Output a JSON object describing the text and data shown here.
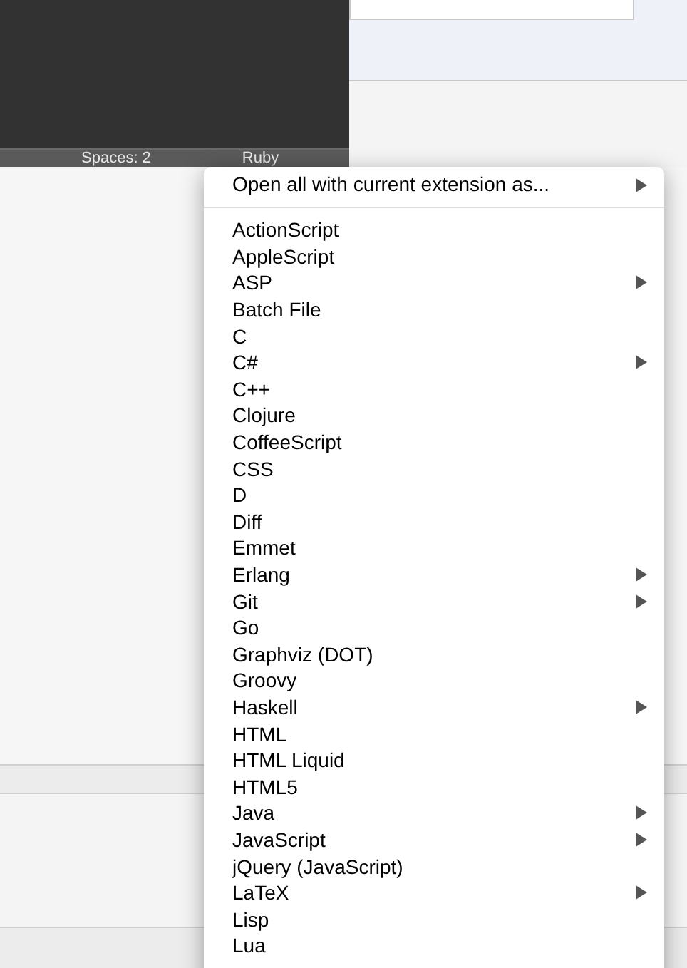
{
  "status_bar": {
    "spaces": "Spaces: 2",
    "syntax": "Ruby"
  },
  "menu": {
    "header": {
      "label": "Open all with current extension as...",
      "submenu": true
    },
    "items": [
      {
        "label": "ActionScript",
        "submenu": false
      },
      {
        "label": "AppleScript",
        "submenu": false
      },
      {
        "label": "ASP",
        "submenu": true
      },
      {
        "label": "Batch File",
        "submenu": false
      },
      {
        "label": "C",
        "submenu": false
      },
      {
        "label": "C#",
        "submenu": true
      },
      {
        "label": "C++",
        "submenu": false
      },
      {
        "label": "Clojure",
        "submenu": false
      },
      {
        "label": "CoffeeScript",
        "submenu": false
      },
      {
        "label": "CSS",
        "submenu": false
      },
      {
        "label": "D",
        "submenu": false
      },
      {
        "label": "Diff",
        "submenu": false
      },
      {
        "label": "Emmet",
        "submenu": false
      },
      {
        "label": "Erlang",
        "submenu": true
      },
      {
        "label": "Git",
        "submenu": true
      },
      {
        "label": "Go",
        "submenu": false
      },
      {
        "label": "Graphviz (DOT)",
        "submenu": false
      },
      {
        "label": "Groovy",
        "submenu": false
      },
      {
        "label": "Haskell",
        "submenu": true
      },
      {
        "label": "HTML",
        "submenu": false
      },
      {
        "label": "HTML Liquid",
        "submenu": false
      },
      {
        "label": "HTML5",
        "submenu": false
      },
      {
        "label": "Java",
        "submenu": true
      },
      {
        "label": "JavaScript",
        "submenu": true
      },
      {
        "label": "jQuery (JavaScript)",
        "submenu": false
      },
      {
        "label": "LaTeX",
        "submenu": true
      },
      {
        "label": "Lisp",
        "submenu": false
      },
      {
        "label": "Lua",
        "submenu": false
      }
    ]
  }
}
